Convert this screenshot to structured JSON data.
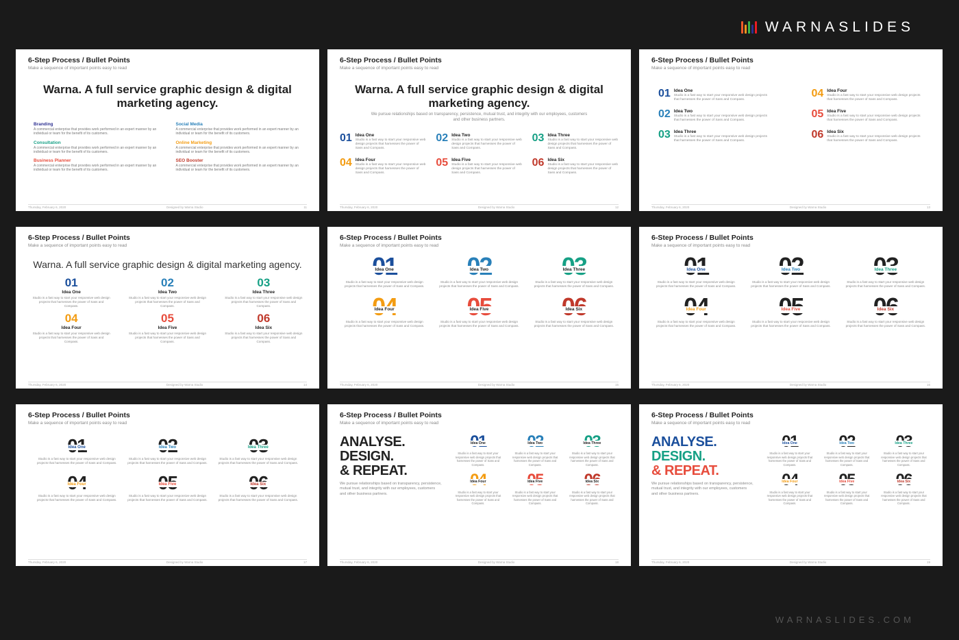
{
  "brand": "WARNASLIDES",
  "watermark": "WARNASLIDES.COM",
  "brandBars": [
    {
      "h": 18,
      "c": "#f15a29"
    },
    {
      "h": 13,
      "c": "#f7941e"
    },
    {
      "h": 18,
      "c": "#39b54a"
    },
    {
      "h": 13,
      "c": "#2e3192"
    },
    {
      "h": 18,
      "c": "#ed1c24"
    }
  ],
  "common": {
    "title": "6-Step Process / Bullet Points",
    "subtitle": "Make a sequence of important points easy to read",
    "footerDate": "Thursday, February 6, 2020",
    "footerCenter": "Designed by Warna Studio",
    "hero": "Warna. A full service graphic design & digital marketing agency.",
    "heroSub": "We pursue relationships based on transparency, persistence, mutual trust, and integrity with our employees, customers and other business partners.",
    "ideaBody": "Studio is a fast way to start your responsive web design projects that harnesses the power of Sass and Compass.",
    "s1Body": "A commercial enterprise that provides work performed in an expert manner by an individual or team for the benefit of its customers.",
    "analyse": "ANALYSE. DESIGN. & REPEAT.",
    "analyse1": "ANALYSE.",
    "analyse2": "DESIGN.",
    "analyse3": "& REPEAT."
  },
  "colors": {
    "c1": "#1b4f9c",
    "c2": "#2980b9",
    "c3": "#16a085",
    "c4": "#f39c12",
    "c5": "#e74c3c",
    "c6": "#c0392b",
    "dark": "#222"
  },
  "s1items": [
    {
      "t": "Branding",
      "c": "#2e3192"
    },
    {
      "t": "Social Media",
      "c": "#2980b9"
    },
    {
      "t": "Consultation",
      "c": "#16a085"
    },
    {
      "t": "Online Marketing",
      "c": "#f39c12"
    },
    {
      "t": "Business Planner",
      "c": "#e74c3c"
    },
    {
      "t": "SEO Booster",
      "c": "#c0392b"
    }
  ],
  "ideas": [
    {
      "n": "01",
      "t": "Idea One"
    },
    {
      "n": "02",
      "t": "Idea Two"
    },
    {
      "n": "03",
      "t": "Idea Three"
    },
    {
      "n": "04",
      "t": "Idea Four"
    },
    {
      "n": "05",
      "t": "Idea Five"
    },
    {
      "n": "06",
      "t": "Idea Six"
    }
  ],
  "s3order": [
    0,
    3,
    1,
    4,
    2,
    5
  ],
  "pages": [
    "11",
    "12",
    "13",
    "14",
    "15",
    "16",
    "17",
    "18",
    "19"
  ]
}
